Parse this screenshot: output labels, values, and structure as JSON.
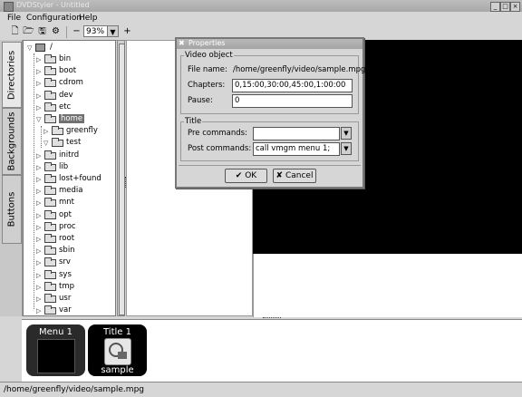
{
  "window": {
    "title": "DVDStyler - Untitled"
  },
  "menubar": {
    "items": [
      "File",
      "Configuration",
      "Help"
    ]
  },
  "toolbar": {
    "zoom": "93%"
  },
  "sidetabs": [
    "Directories",
    "Backgrounds",
    "Buttons"
  ],
  "tree": {
    "root": "/",
    "items": [
      "bin",
      "boot",
      "cdrom",
      "dev",
      "etc",
      "home",
      "greenfly",
      "test",
      "initrd",
      "lib",
      "lost+found",
      "media",
      "mnt",
      "opt",
      "proc",
      "root",
      "sbin",
      "srv",
      "sys",
      "tmp",
      "usr",
      "var"
    ]
  },
  "thumbnails": [
    {
      "label": "Menu 1"
    },
    {
      "label": "Title 1",
      "caption": "sample"
    }
  ],
  "statusbar": {
    "text": "/home/greenfly/video/sample.mpg"
  },
  "dialog": {
    "title": "Properties",
    "video_group": "Video object",
    "file_name_label": "File name:",
    "file_name_value": "/home/greenfly/video/sample.mpg",
    "chapters_label": "Chapters:",
    "chapters_value": "0,15:00,30:00,45:00,1:00:00",
    "pause_label": "Pause:",
    "pause_value": "0",
    "title_group": "Title",
    "pre_label": "Pre commands:",
    "pre_value": "",
    "post_label": "Post commands:",
    "post_value": "call vmgm menu 1;",
    "ok_label": "OK",
    "cancel_label": "Cancel"
  }
}
